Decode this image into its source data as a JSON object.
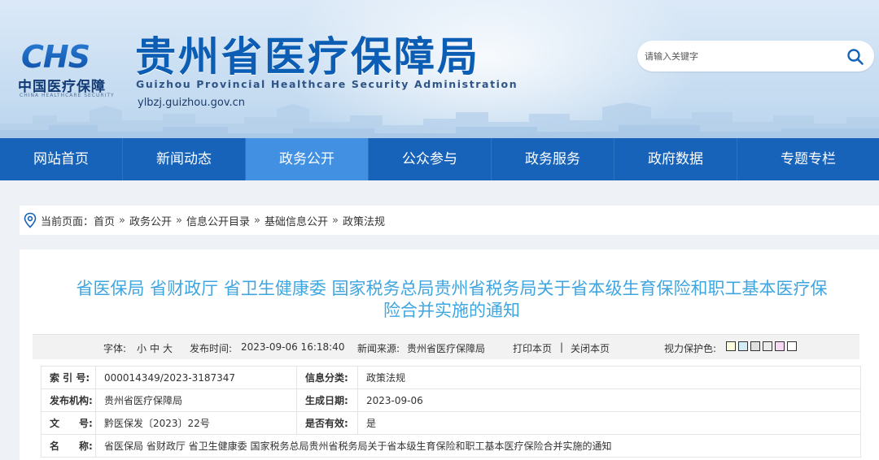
{
  "header": {
    "logo_text": "CHS",
    "brand_cn": "中国医疗保障",
    "brand_en": "CHINA HEALTHCARE SECURITY",
    "title": "贵州省医疗保障局",
    "title_en": "Guizhou Provincial Healthcare Security Administration",
    "url": "ylbzj.guizhou.gov.cn"
  },
  "search": {
    "placeholder": "请输入关键字",
    "icon": "search-icon"
  },
  "nav": {
    "items": [
      {
        "label": "网站首页"
      },
      {
        "label": "新闻动态"
      },
      {
        "label": "政务公开"
      },
      {
        "label": "公众参与"
      },
      {
        "label": "政务服务"
      },
      {
        "label": "政府数据"
      },
      {
        "label": "专题专栏"
      }
    ],
    "active": "政务公开"
  },
  "breadcrumb": {
    "prefix": "当前页面：",
    "items": [
      "首页",
      "政务公开",
      "信息公开目录",
      "基础信息公开",
      "政策法规"
    ],
    "separator": "»"
  },
  "article": {
    "title_line1": "省医保局 省财政厅 省卫生健康委 国家税务总局贵州省税务局关于省本级生育保险和职工基本医疗保",
    "title_line2": "险合并实施的通知",
    "meta": {
      "font_label": "字体:",
      "font_small": "小",
      "font_medium": "中",
      "font_large": "大",
      "publish_label": "发布时间:",
      "publish_time": "2023-09-06 16:18:40",
      "source_label": "新闻来源:",
      "source": "贵州省医疗保障局",
      "print": "打印本页",
      "divider": "|",
      "close": "关闭本页",
      "eye_label": "视力保护色:",
      "swatch_colors": [
        "#ffffe0",
        "#d4ecf8",
        "#e0e0e0",
        "#ececec",
        "#f5d9f5",
        "#ffffff"
      ]
    },
    "info": {
      "index_label": "索 引 号:",
      "index_value": "000014349/2023-3187347",
      "category_label": "信息分类:",
      "category_value": "政策法规",
      "org_label": "发布机构:",
      "org_value": "贵州省医疗保障局",
      "date_label": "生成日期:",
      "date_value": "2023-09-06",
      "doc_label": "文　　号:",
      "doc_value": "黔医保发〔2023〕22号",
      "valid_label": "是否有效:",
      "valid_value": "是",
      "name_label": "名　　称:",
      "name_value": "省医保局 省财政厅 省卫生健康委 国家税务总局贵州省税务局关于省本级生育保险和职工基本医疗保险合并实施的通知"
    }
  },
  "colors": {
    "nav": "#1763b9",
    "nav_active": "#4190e1",
    "title": "#3fa6e0",
    "brand": "#0c5db4"
  }
}
